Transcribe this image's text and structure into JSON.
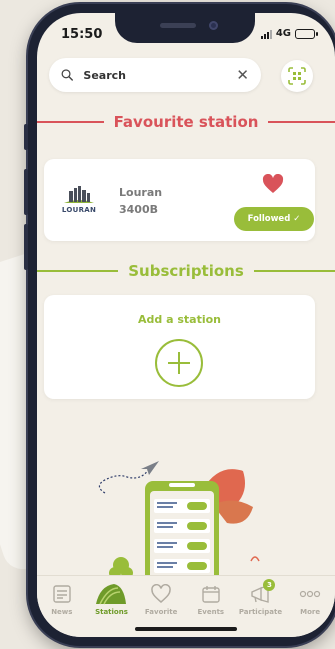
{
  "status": {
    "time": "15:50",
    "network": "4G"
  },
  "search": {
    "placeholder": "Search"
  },
  "favourite": {
    "title": "Favourite station",
    "station": {
      "logo_text": "LOURAN",
      "name": "Louran",
      "code": "3400B",
      "follow_label": "Followed ✓"
    }
  },
  "subscriptions": {
    "title": "Subscriptions",
    "add_label": "Add a station"
  },
  "tabs": [
    {
      "label": "News",
      "icon": "newspaper-icon"
    },
    {
      "label": "Stations",
      "icon": "stations-icon"
    },
    {
      "label": "Favorite",
      "icon": "heart-icon"
    },
    {
      "label": "Events",
      "icon": "calendar-icon"
    },
    {
      "label": "Participate",
      "icon": "megaphone-icon",
      "badge": "3"
    },
    {
      "label": "More",
      "icon": "more-icon"
    }
  ],
  "colors": {
    "accent_green": "#99bd3a",
    "accent_red": "#d9535a",
    "background": "#f3efe7"
  }
}
